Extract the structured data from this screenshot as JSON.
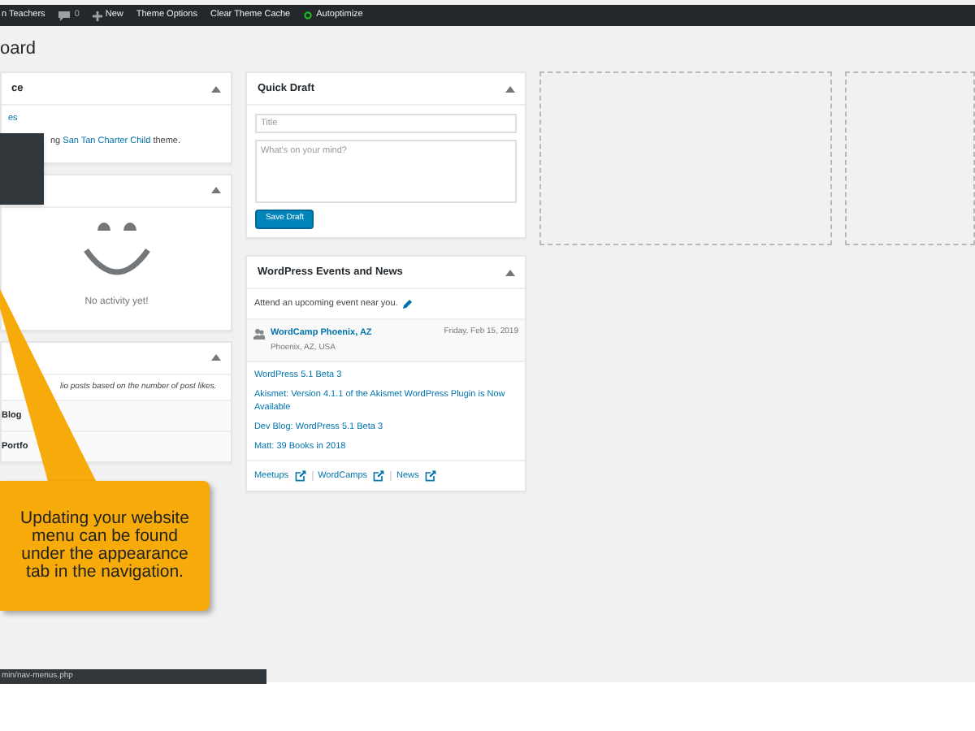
{
  "admin_bar": {
    "site_name": "n Teachers",
    "comments_count": "0",
    "new_label": "New",
    "items": [
      "Theme Options",
      "Clear Theme Cache"
    ],
    "autoptimize": "Autoptimize"
  },
  "page_title": "oard",
  "glance": {
    "title": "ce",
    "link": "es",
    "text_before": "ng ",
    "theme_link": "San Tan Charter Child",
    "text_after": " theme."
  },
  "activity": {
    "message": "No activity yet!"
  },
  "likes": {
    "description": "lio posts based on the number of post likes.",
    "rows": [
      "Blog",
      "Portfo"
    ]
  },
  "quick_draft": {
    "title": "Quick Draft",
    "title_placeholder": "Title",
    "content_placeholder": "What's on your mind?",
    "button": "Save Draft"
  },
  "events": {
    "title": "WordPress Events and News",
    "intro": "Attend an upcoming event near you.",
    "event": {
      "name": "WordCamp Phoenix, AZ",
      "location": "Phoenix, AZ, USA",
      "date": "Friday, Feb 15, 2019"
    },
    "news": [
      "WordPress 5.1 Beta 3",
      "Akismet: Version 4.1.1 of the Akismet WordPress Plugin is Now Available",
      "Dev Blog: WordPress 5.1 Beta 3",
      "Matt: 39 Books in 2018"
    ],
    "footer_links": [
      "Meetups",
      "WordCamps",
      "News"
    ]
  },
  "callout": {
    "text": "Updating your website menu can be found under the appearance tab in the navigation."
  },
  "status_url": "min/nav-menus.php"
}
